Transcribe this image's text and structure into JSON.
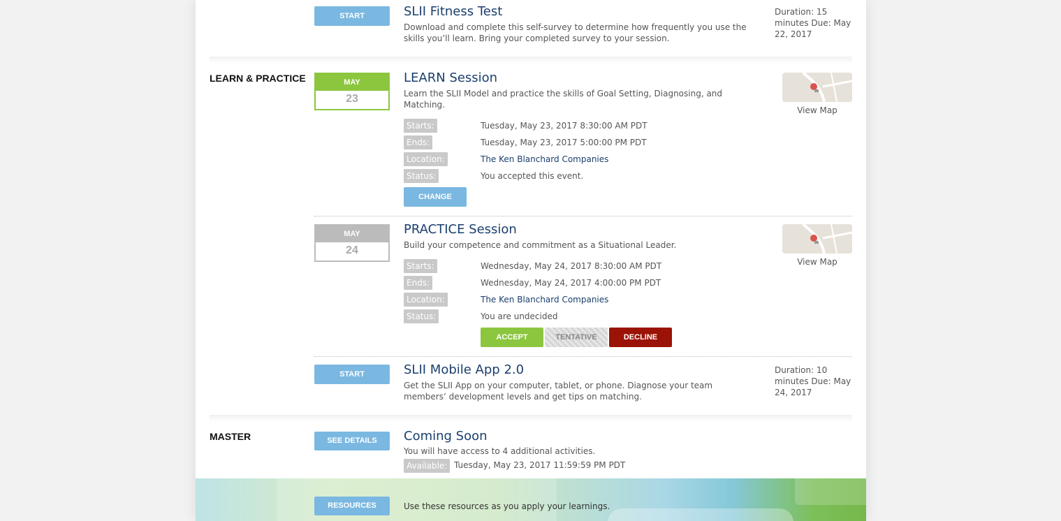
{
  "fitness": {
    "button": "START",
    "title": "SLII Fitness Test",
    "description": "Download and complete this self-survey to determine how frequently you use the skills you’ll learn. Bring your completed survey to your session.",
    "duration": "Duration: 15 minutes Due: May 22, 2017"
  },
  "learn_practice": {
    "stage_label": "LEARN & PRACTICE",
    "learn": {
      "month": "MAY",
      "day": "23",
      "title": "LEARN Session",
      "description": "Learn the SLII Model and practice the skills of Goal Setting, Diagnosing, and Matching.",
      "labels": {
        "starts": "Starts:",
        "ends": "Ends:",
        "location": "Location:",
        "status": "Status:"
      },
      "starts": "Tuesday, May 23, 2017 8:30:00 AM PDT",
      "ends": "Tuesday, May 23, 2017 5:00:00 PM PDT",
      "location": "The Ken Blanchard Companies",
      "status": "You accepted this event.",
      "change_button": "CHANGE",
      "view_map": "View Map"
    },
    "practice": {
      "month": "MAY",
      "day": "24",
      "title": "PRACTICE Session",
      "description": "Build your competence and commitment as a Situational Leader.",
      "labels": {
        "starts": "Starts:",
        "ends": "Ends:",
        "location": "Location:",
        "status": "Status:"
      },
      "starts": "Wednesday, May 24, 2017 8:30:00 AM PDT",
      "ends": "Wednesday, May 24, 2017 4:00:00 PM PDT",
      "location": "The Ken Blanchard Companies",
      "status": "You are undecided",
      "accept_button": "ACCEPT",
      "tentative_button": "TENTATIVE",
      "decline_button": "DECLINE",
      "view_map": "View Map"
    },
    "mobile_app": {
      "button": "START",
      "title": "SLII Mobile App 2.0",
      "description": "Get the SLII App on your computer, tablet, or phone. Diagnose your team members’ development levels and get tips on matching.",
      "duration": "Duration: 10 minutes Due: May 24, 2017"
    }
  },
  "master": {
    "stage_label": "MASTER",
    "button": "SEE DETAILS",
    "title": "Coming Soon",
    "description": "You will have access to 4 additional activities.",
    "available_label": "Available:",
    "available_value": "Tuesday, May 23, 2017 11:59:59 PM PDT"
  },
  "resources": {
    "button": "RESOURCES",
    "text": "Use these resources as you apply your learnings."
  },
  "colors": {
    "button_blue": "#7ab8e1",
    "accept_green": "#8cc63f",
    "decline_red": "#9b1306",
    "title_navy": "#1b3f6e"
  }
}
